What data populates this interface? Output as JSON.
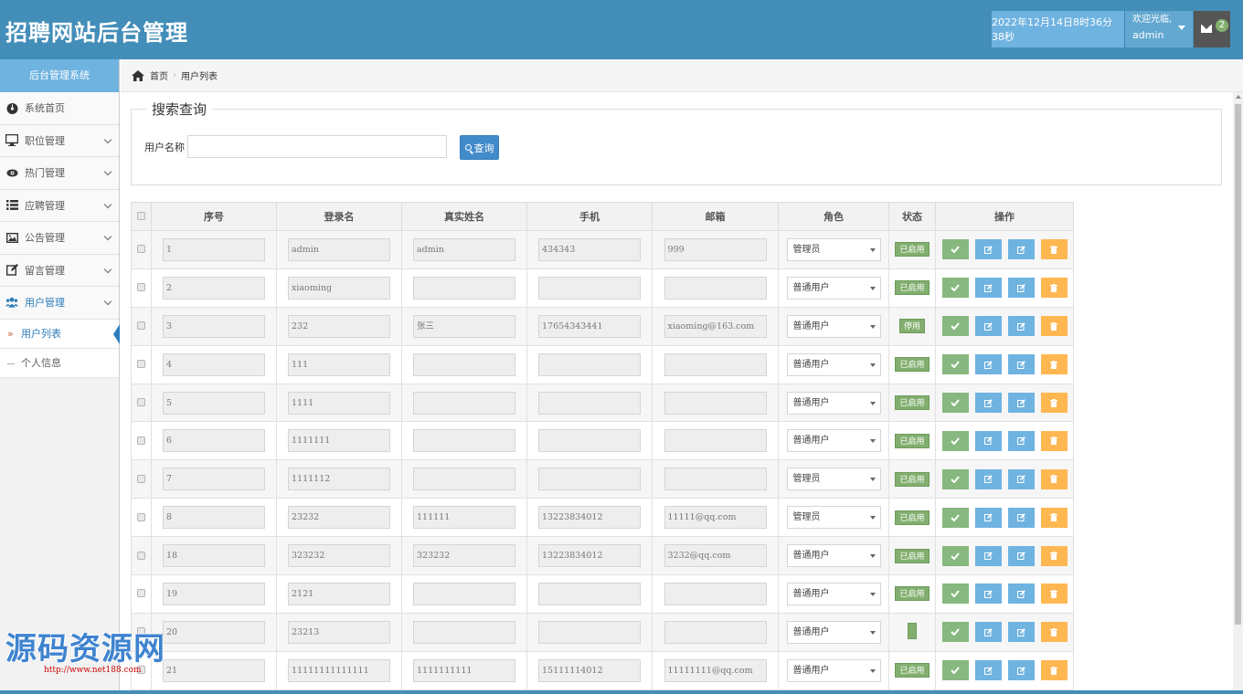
{
  "header": {
    "title": "招聘网站后台管理",
    "datetime": "2022年12月14日8时36分38秒",
    "welcome": "欢迎光临,",
    "username": "admin",
    "mail_count": "2"
  },
  "sidebar": {
    "title": "后台管理系统",
    "items": [
      {
        "label": "系统首页",
        "icon": "dashboard-icon"
      },
      {
        "label": "职位管理",
        "icon": "desktop-icon"
      },
      {
        "label": "热门管理",
        "icon": "eye-icon"
      },
      {
        "label": "应聘管理",
        "icon": "list-icon"
      },
      {
        "label": "公告管理",
        "icon": "picture-icon"
      },
      {
        "label": "留言管理",
        "icon": "edit-icon"
      },
      {
        "label": "用户管理",
        "icon": "users-icon"
      }
    ],
    "subitems": [
      {
        "label": "用户列表"
      },
      {
        "label": "个人信息"
      }
    ]
  },
  "breadcrumb": {
    "home": "首页",
    "current": "用户列表"
  },
  "search": {
    "legend": "搜索查询",
    "label": "用户名称",
    "value": "",
    "button": "查询"
  },
  "table": {
    "headers": [
      "序号",
      "登录名",
      "真实姓名",
      "手机",
      "邮箱",
      "角色",
      "状态",
      "操作"
    ],
    "rows": [
      {
        "id": "1",
        "login": "admin",
        "name": "admin",
        "phone": "434343",
        "email": "999",
        "role": "管理员",
        "status": "已启用"
      },
      {
        "id": "2",
        "login": "xiaoming",
        "name": "",
        "phone": "",
        "email": "",
        "role": "普通用户",
        "status": "已启用"
      },
      {
        "id": "3",
        "login": "232",
        "name": "张三",
        "phone": "17654343441",
        "email": "xiaoming@163.com",
        "role": "普通用户",
        "status": "停用"
      },
      {
        "id": "4",
        "login": "111",
        "name": "",
        "phone": "",
        "email": "",
        "role": "普通用户",
        "status": "已启用"
      },
      {
        "id": "5",
        "login": "1111",
        "name": "",
        "phone": "",
        "email": "",
        "role": "普通用户",
        "status": "已启用"
      },
      {
        "id": "6",
        "login": "1111111",
        "name": "",
        "phone": "",
        "email": "",
        "role": "普通用户",
        "status": "已启用"
      },
      {
        "id": "7",
        "login": "1111112",
        "name": "",
        "phone": "",
        "email": "",
        "role": "管理员",
        "status": "已启用"
      },
      {
        "id": "8",
        "login": "23232",
        "name": "111111",
        "phone": "13223834012",
        "email": "11111@qq.com",
        "role": "管理员",
        "status": "已启用"
      },
      {
        "id": "18",
        "login": "323232",
        "name": "323232",
        "phone": "13223834012",
        "email": "3232@qq.com",
        "role": "普通用户",
        "status": "已启用"
      },
      {
        "id": "19",
        "login": "2121",
        "name": "",
        "phone": "",
        "email": "",
        "role": "普通用户",
        "status": "已启用"
      },
      {
        "id": "20",
        "login": "23213",
        "name": "",
        "phone": "",
        "email": "",
        "role": "普通用户",
        "status": ""
      },
      {
        "id": "21",
        "login": "11111111111111",
        "name": "1111111111",
        "phone": "15111114012",
        "email": "11111111@qq.com",
        "role": "普通用户",
        "status": "已启用"
      }
    ]
  },
  "watermark": {
    "title": "源码资源网",
    "url": "http://www.net188.com"
  },
  "colors": {
    "header_bg": "#438eb9",
    "accent": "#2b7dbc",
    "status_green": "#82af6f",
    "btn_ok": "#87b87f",
    "btn_edit": "#6fb3e0",
    "btn_delete": "#ffb752"
  }
}
